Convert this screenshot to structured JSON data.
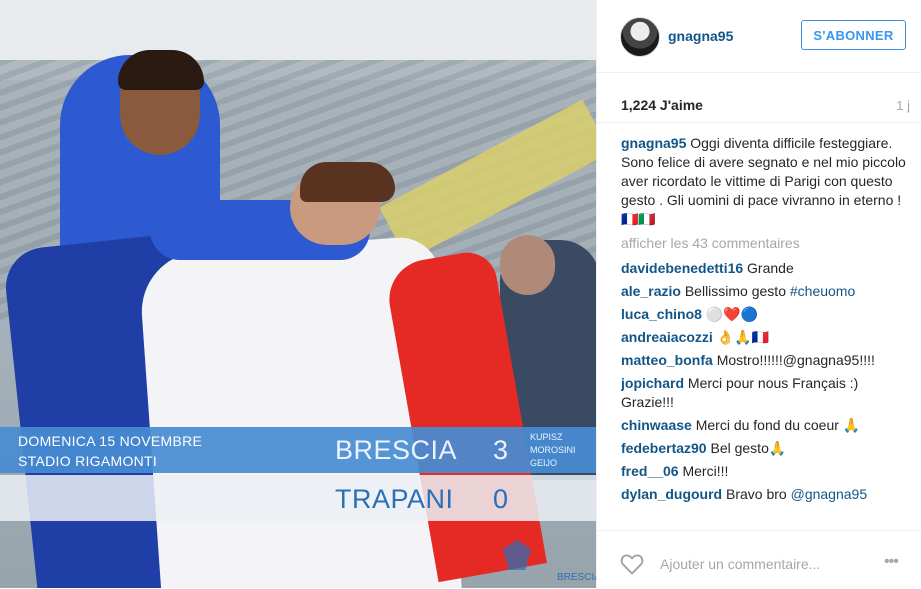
{
  "photo": {
    "scoreboard": {
      "date": "DOMENICA 15 NOVEMBRE",
      "venue": "STADIO RIGAMONTI",
      "home_team": "BRESCIA",
      "home_score": "3",
      "scorers": [
        "KUPISZ",
        "MOROSINI",
        "GEIJO"
      ],
      "away_team": "TRAPANI",
      "away_score": "0"
    },
    "logo_text": "BRESCIA"
  },
  "header": {
    "username": "gnagna95",
    "follow_label": "S'ABONNER"
  },
  "meta": {
    "likes": "1,224 J'aime",
    "time": "1 j"
  },
  "caption": {
    "username": "gnagna95",
    "text": "Oggi diventa difficile festeggiare. Sono felice di avere segnato e nel mio piccolo aver ricordato le vittime di Parigi con questo gesto . Gli uomini di pace vivranno in eterno ! 🇫🇷🇮🇹"
  },
  "view_all": "afficher les 43 commentaires",
  "comments": [
    {
      "user": "davidebenedetti16",
      "text": "Grande",
      "tag": ""
    },
    {
      "user": "ale_razio",
      "text": "Bellissimo gesto ",
      "tag": "#cheuomo"
    },
    {
      "user": "luca_chino8",
      "text": "⚪❤️🔵",
      "tag": ""
    },
    {
      "user": "andreaiacozzi",
      "text": "👌🙏🇫🇷",
      "tag": ""
    },
    {
      "user": "matteo_bonfa",
      "text": "Mostro!!!!!!@gnagna95!!!!",
      "tag": ""
    },
    {
      "user": "jopichard",
      "text": "Merci pour nous Français :) Grazie!!!",
      "tag": ""
    },
    {
      "user": "chinwaase",
      "text": "Merci du fond du coeur 🙏",
      "tag": ""
    },
    {
      "user": "fedebertaz90",
      "text": "Bel gesto🙏",
      "tag": ""
    },
    {
      "user": "fred__06",
      "text": "Merci!!!",
      "tag": ""
    },
    {
      "user": "dylan_dugourd",
      "text": "Bravo bro ",
      "tag": "@gnagna95"
    }
  ],
  "comment_input": {
    "placeholder": "Ajouter un commentaire..."
  },
  "icons": {
    "like": "heart-icon",
    "more": "more-options-icon"
  },
  "colors": {
    "username_link": "#125688",
    "follow_blue": "#3897f0",
    "muted": "#a5a7aa"
  }
}
